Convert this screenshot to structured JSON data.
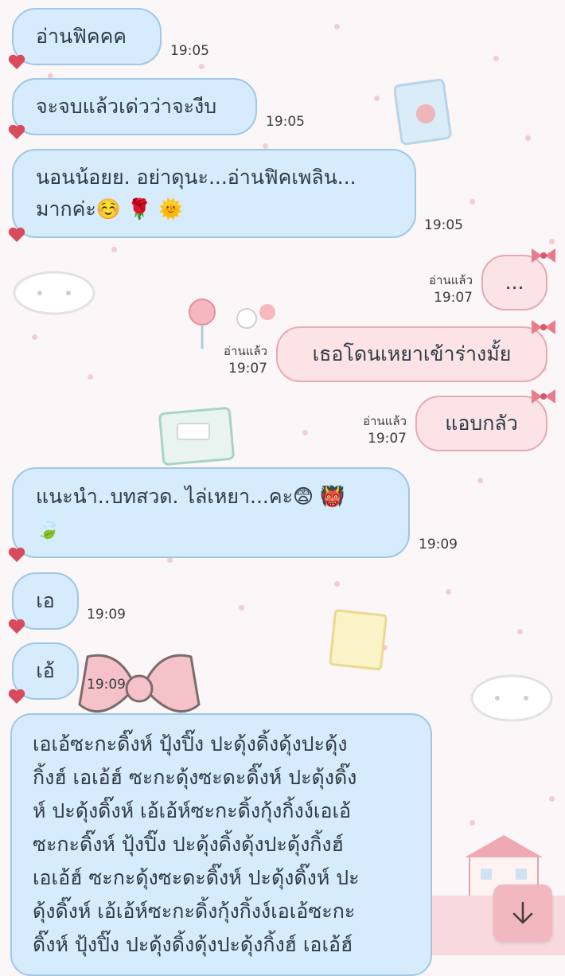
{
  "messages": [
    {
      "text": "อ่านฟิคคค",
      "time": "19:05"
    },
    {
      "text": "จะจบแล้วเด่วว่าจะงีบ",
      "time": "19:05"
    },
    {
      "line1": "นอนน้อยย. อย่าดุนะ...อ่านฟิคเพลิน...",
      "line2": "มากค่ะ☺️ 🌹 🌞",
      "time": "19:05"
    },
    {
      "text": "...",
      "read": "อ่านแล้ว",
      "time": "19:07"
    },
    {
      "text": "เธอโดนเหยาเข้าร่างมั้ย",
      "read": "อ่านแล้ว",
      "time": "19:07"
    },
    {
      "text": "แอบกลัว",
      "read": "อ่านแล้ว",
      "time": "19:07"
    },
    {
      "line1": "แนะนำ..บทสวด. ไล่เหยา...คะ😨 👹",
      "line2": "🍃",
      "time": "19:09"
    },
    {
      "text": "เอ",
      "time": "19:09"
    },
    {
      "text": "เอ้",
      "time": "19:09"
    },
    {
      "lines": [
        "เอเอ้ซะกะดิ๊งห์ ปุ้งปิ๊ง ปะดุ้งดิ้งดุ้งปะดุ้ง",
        "กิ้งฮ์ เอเอ้ฮ์ ซะกะดุ้งซะดะดิ๊งห์ ปะดุ้งดิ๊ง",
        "ห์ ปะดุ้งดิ๊งห์ เอ้เอ้ห์ซะกะดิ้งกุ้งกิ้งง์เอเอ้",
        "ซะกะดิ๊งห์ ปุ้งปิ๊ง ปะดุ้งดิ้งดุ้งปะดุ้งกิ้งฮ์",
        "เอเอ้ฮ์ ซะกะดุ้งซะดะดิ๊งห์ ปะดุ้งดิ๊งห์ ปะ",
        "ดุ้งดิ๊งห์ เอ้เอ้ห์ซะกะดิ้งกุ้งกิ้งง์เอเอ้ซะกะ",
        "ดิ๊งห์ ปุ้งปิ๊ง ปะดุ้งดิ้งดุ้งปะดุ้งกิ้งฮ์ เอเอ้ฮ์"
      ]
    }
  ],
  "icons": {
    "scroll_down": "arrow-down-icon",
    "incoming_tail": "heart-icon",
    "outgoing_tail": "bow-icon"
  },
  "colors": {
    "incoming_bubble": "#d6ebfb",
    "outgoing_bubble": "#fbe3e6",
    "scroll_button": "#f2b8c0"
  }
}
